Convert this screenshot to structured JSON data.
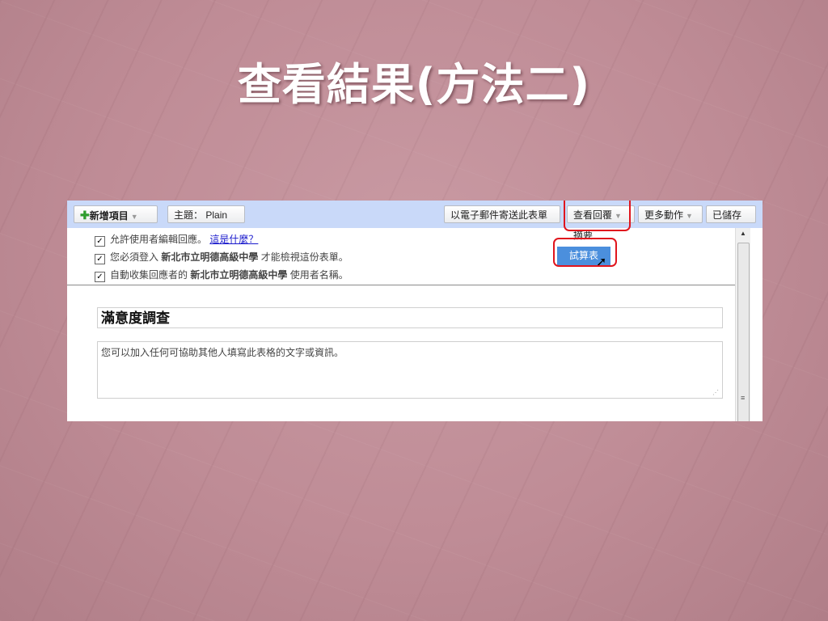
{
  "slide": {
    "title": "查看結果(方法二)"
  },
  "toolbar": {
    "add_item": "新增項目",
    "theme_label": "主題：",
    "theme_value": "Plain",
    "email_form": "以電子郵件寄送此表單",
    "view_responses": "查看回覆",
    "more_actions": "更多動作",
    "saved": "已儲存"
  },
  "dropdown": {
    "summary": "摘要",
    "spreadsheet": "試算表"
  },
  "settings": {
    "allow_edit": "允許使用者編輯回應。",
    "what_is_this": "這是什麼？",
    "must_sign_in_pre": "您必須登入",
    "org": "新北市立明德高級中學",
    "must_sign_in_post": "才能檢視這份表單。",
    "auto_collect_pre": "自動收集回應者的",
    "auto_collect_post": "使用者名稱。"
  },
  "form": {
    "title": "滿意度調查",
    "description": "您可以加入任何可協助其他人填寫此表格的文字或資訊。"
  },
  "colors": {
    "slide_bg": "#c29199",
    "toolbar_bg": "#c9d9f9",
    "highlight": "#e0151d",
    "selected_item": "#4b8fdd"
  }
}
